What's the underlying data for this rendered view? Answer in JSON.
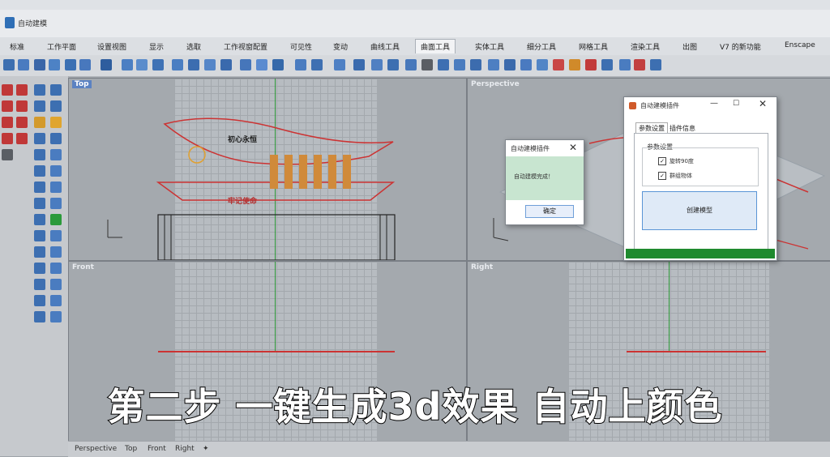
{
  "app": {
    "title": "自动建模"
  },
  "tabs": [
    {
      "label": "标准"
    },
    {
      "label": "工作平面"
    },
    {
      "label": "设置视图"
    },
    {
      "label": "显示"
    },
    {
      "label": "选取"
    },
    {
      "label": "工作视窗配置"
    },
    {
      "label": "可见性"
    },
    {
      "label": "变动"
    },
    {
      "label": "曲线工具"
    },
    {
      "label": "曲面工具"
    },
    {
      "label": "实体工具"
    },
    {
      "label": "细分工具"
    },
    {
      "label": "网格工具"
    },
    {
      "label": "渲染工具"
    },
    {
      "label": "出图"
    },
    {
      "label": "V7 的新功能"
    },
    {
      "label": "Enscape"
    }
  ],
  "active_tab": "曲面工具",
  "viewports": {
    "top": {
      "label": "Top"
    },
    "perspective": {
      "label": "Perspective"
    },
    "front": {
      "label": "Front"
    },
    "right": {
      "label": "Right"
    }
  },
  "model": {
    "banner_text_1": "牢记使命",
    "banner_text_2": "初心永恒"
  },
  "dialog_done": {
    "title": "自动建模插件",
    "message": "自动建模完成！",
    "ok_label": "确定"
  },
  "dialog_main": {
    "title": "自动建模插件",
    "tabs": [
      "参数设置",
      "插件信息"
    ],
    "group_label": "参数设置",
    "options": [
      {
        "label": "旋转90度",
        "checked": true
      },
      {
        "label": "群组物体",
        "checked": true
      }
    ],
    "create_button": "创建模型",
    "progress": 1.0,
    "progress_color": "#1f8a2e"
  },
  "caption": "第二步 一键生成3d效果 自动上颜色",
  "bottom_tabs": [
    {
      "label": "Perspective"
    },
    {
      "label": "Top"
    },
    {
      "label": "Front"
    },
    {
      "label": "Right"
    }
  ]
}
